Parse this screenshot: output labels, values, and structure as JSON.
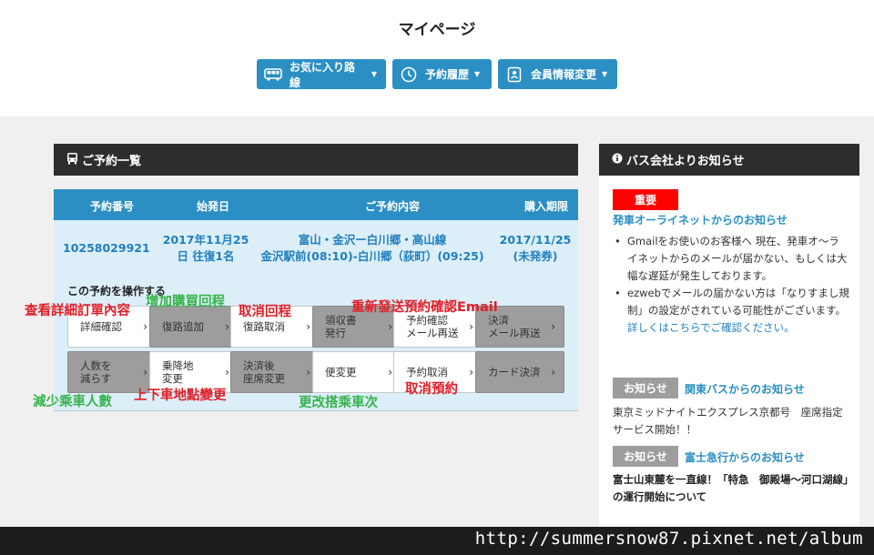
{
  "header": {
    "title": "マイページ"
  },
  "nav": [
    {
      "label": "お気に入り路線"
    },
    {
      "label": "予約履歴"
    },
    {
      "label": "会員情報変更"
    }
  ],
  "reservations": {
    "heading": "ご予約一覧",
    "columns": [
      "予約番号",
      "始発日",
      "ご予約内容",
      "購入期限"
    ],
    "row": {
      "number": "10258029921",
      "date_line1": "2017年11月25",
      "date_line2": "日 往復1名",
      "route_line1": "富山・金沢ー白川郷・高山線",
      "route_line2": "金沢駅前(08:10)-白川郷（荻町）(09:25)",
      "deadline_line1": "2017/11/25",
      "deadline_line2": "(未発券)"
    },
    "operate_label": "この予約を操作する",
    "buttons_row1": [
      {
        "lines": [
          "詳細確認"
        ],
        "enabled": true
      },
      {
        "lines": [
          "復路追加"
        ],
        "enabled": false
      },
      {
        "lines": [
          "復路取消"
        ],
        "enabled": true
      },
      {
        "lines": [
          "領収書",
          "発行"
        ],
        "enabled": false
      },
      {
        "lines": [
          "予約確認",
          "メール再送"
        ],
        "enabled": true
      },
      {
        "lines": [
          "決済",
          "メール再送"
        ],
        "enabled": false
      }
    ],
    "buttons_row2": [
      {
        "lines": [
          "人数を",
          "減らす"
        ],
        "enabled": false
      },
      {
        "lines": [
          "乗降地",
          "変更"
        ],
        "enabled": true
      },
      {
        "lines": [
          "決済後",
          "座席変更"
        ],
        "enabled": false
      },
      {
        "lines": [
          "便変更"
        ],
        "enabled": true
      },
      {
        "lines": [
          "予約取消"
        ],
        "enabled": true
      },
      {
        "lines": [
          "カード決済"
        ],
        "enabled": false
      }
    ]
  },
  "annotations": [
    {
      "text": "查看詳細訂單內容",
      "color": "red"
    },
    {
      "text": "增加購買回程",
      "color": "green"
    },
    {
      "text": "取消回程",
      "color": "red"
    },
    {
      "text": "重新發送預約確認Email",
      "color": "red"
    },
    {
      "text": "減少乘車人數",
      "color": "green"
    },
    {
      "text": "上下車地點變更",
      "color": "red"
    },
    {
      "text": "更改搭乘車次",
      "color": "green"
    },
    {
      "text": "取消預約",
      "color": "red"
    }
  ],
  "news": {
    "heading": "バス会社よりお知らせ",
    "important_badge": "重要",
    "important_title": "発車オーライネットからのお知らせ",
    "items": [
      "Gmailをお使いのお客様へ 現在、発車オ～ライネットからのメールが届かない、もしくは大幅な遅延が発生しております。",
      "ezwebでメールの届かない方は「なりすまし規制」の設定がされている可能性がございます。"
    ],
    "detail_link": "詳しくはこちらでご確認ください。",
    "notice1_badge": "お知らせ",
    "notice1_title": "関東バスからのお知らせ",
    "notice1_text": "東京ミッドナイトエクスプレス京都号　座席指定サービス開始！！",
    "notice2_badge": "お知らせ",
    "notice2_title": "富士急行からのお知らせ",
    "notice2_text": "富士山東麓を一直線！「特急　御殿場～河口湖線」の運行開始について"
  },
  "watermark": "http://summersnow87.pixnet.net/album",
  "colors": {
    "primary": "#2b8fc4",
    "dark": "#2d2d2d",
    "important": "#ff0000",
    "disabled": "#9d9d9d"
  }
}
